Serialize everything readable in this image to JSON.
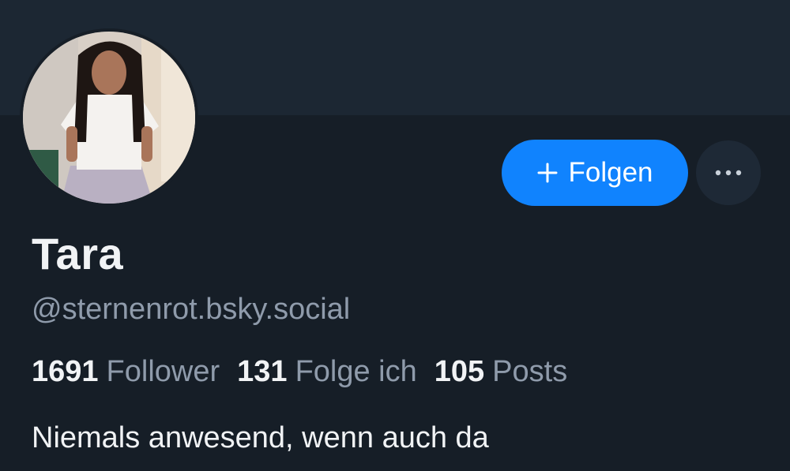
{
  "profile": {
    "display_name": "Tara",
    "handle": "@sternenrot.bsky.social",
    "bio": "Niemals anwesend, wenn auch da",
    "avatar_icon": "profile-photo"
  },
  "stats": {
    "followers_count": "1691",
    "followers_label": "Follower",
    "following_count": "131",
    "following_label": "Folge ich",
    "posts_count": "105",
    "posts_label": "Posts"
  },
  "actions": {
    "follow_label": "Folgen",
    "follow_icon": "plus-icon",
    "more_icon": "more-horizontal-icon"
  },
  "colors": {
    "background": "#161e27",
    "banner": "#1c2733",
    "accent": "#1083fe",
    "text_primary": "#f1f3f5",
    "text_secondary": "#8f9bab"
  }
}
